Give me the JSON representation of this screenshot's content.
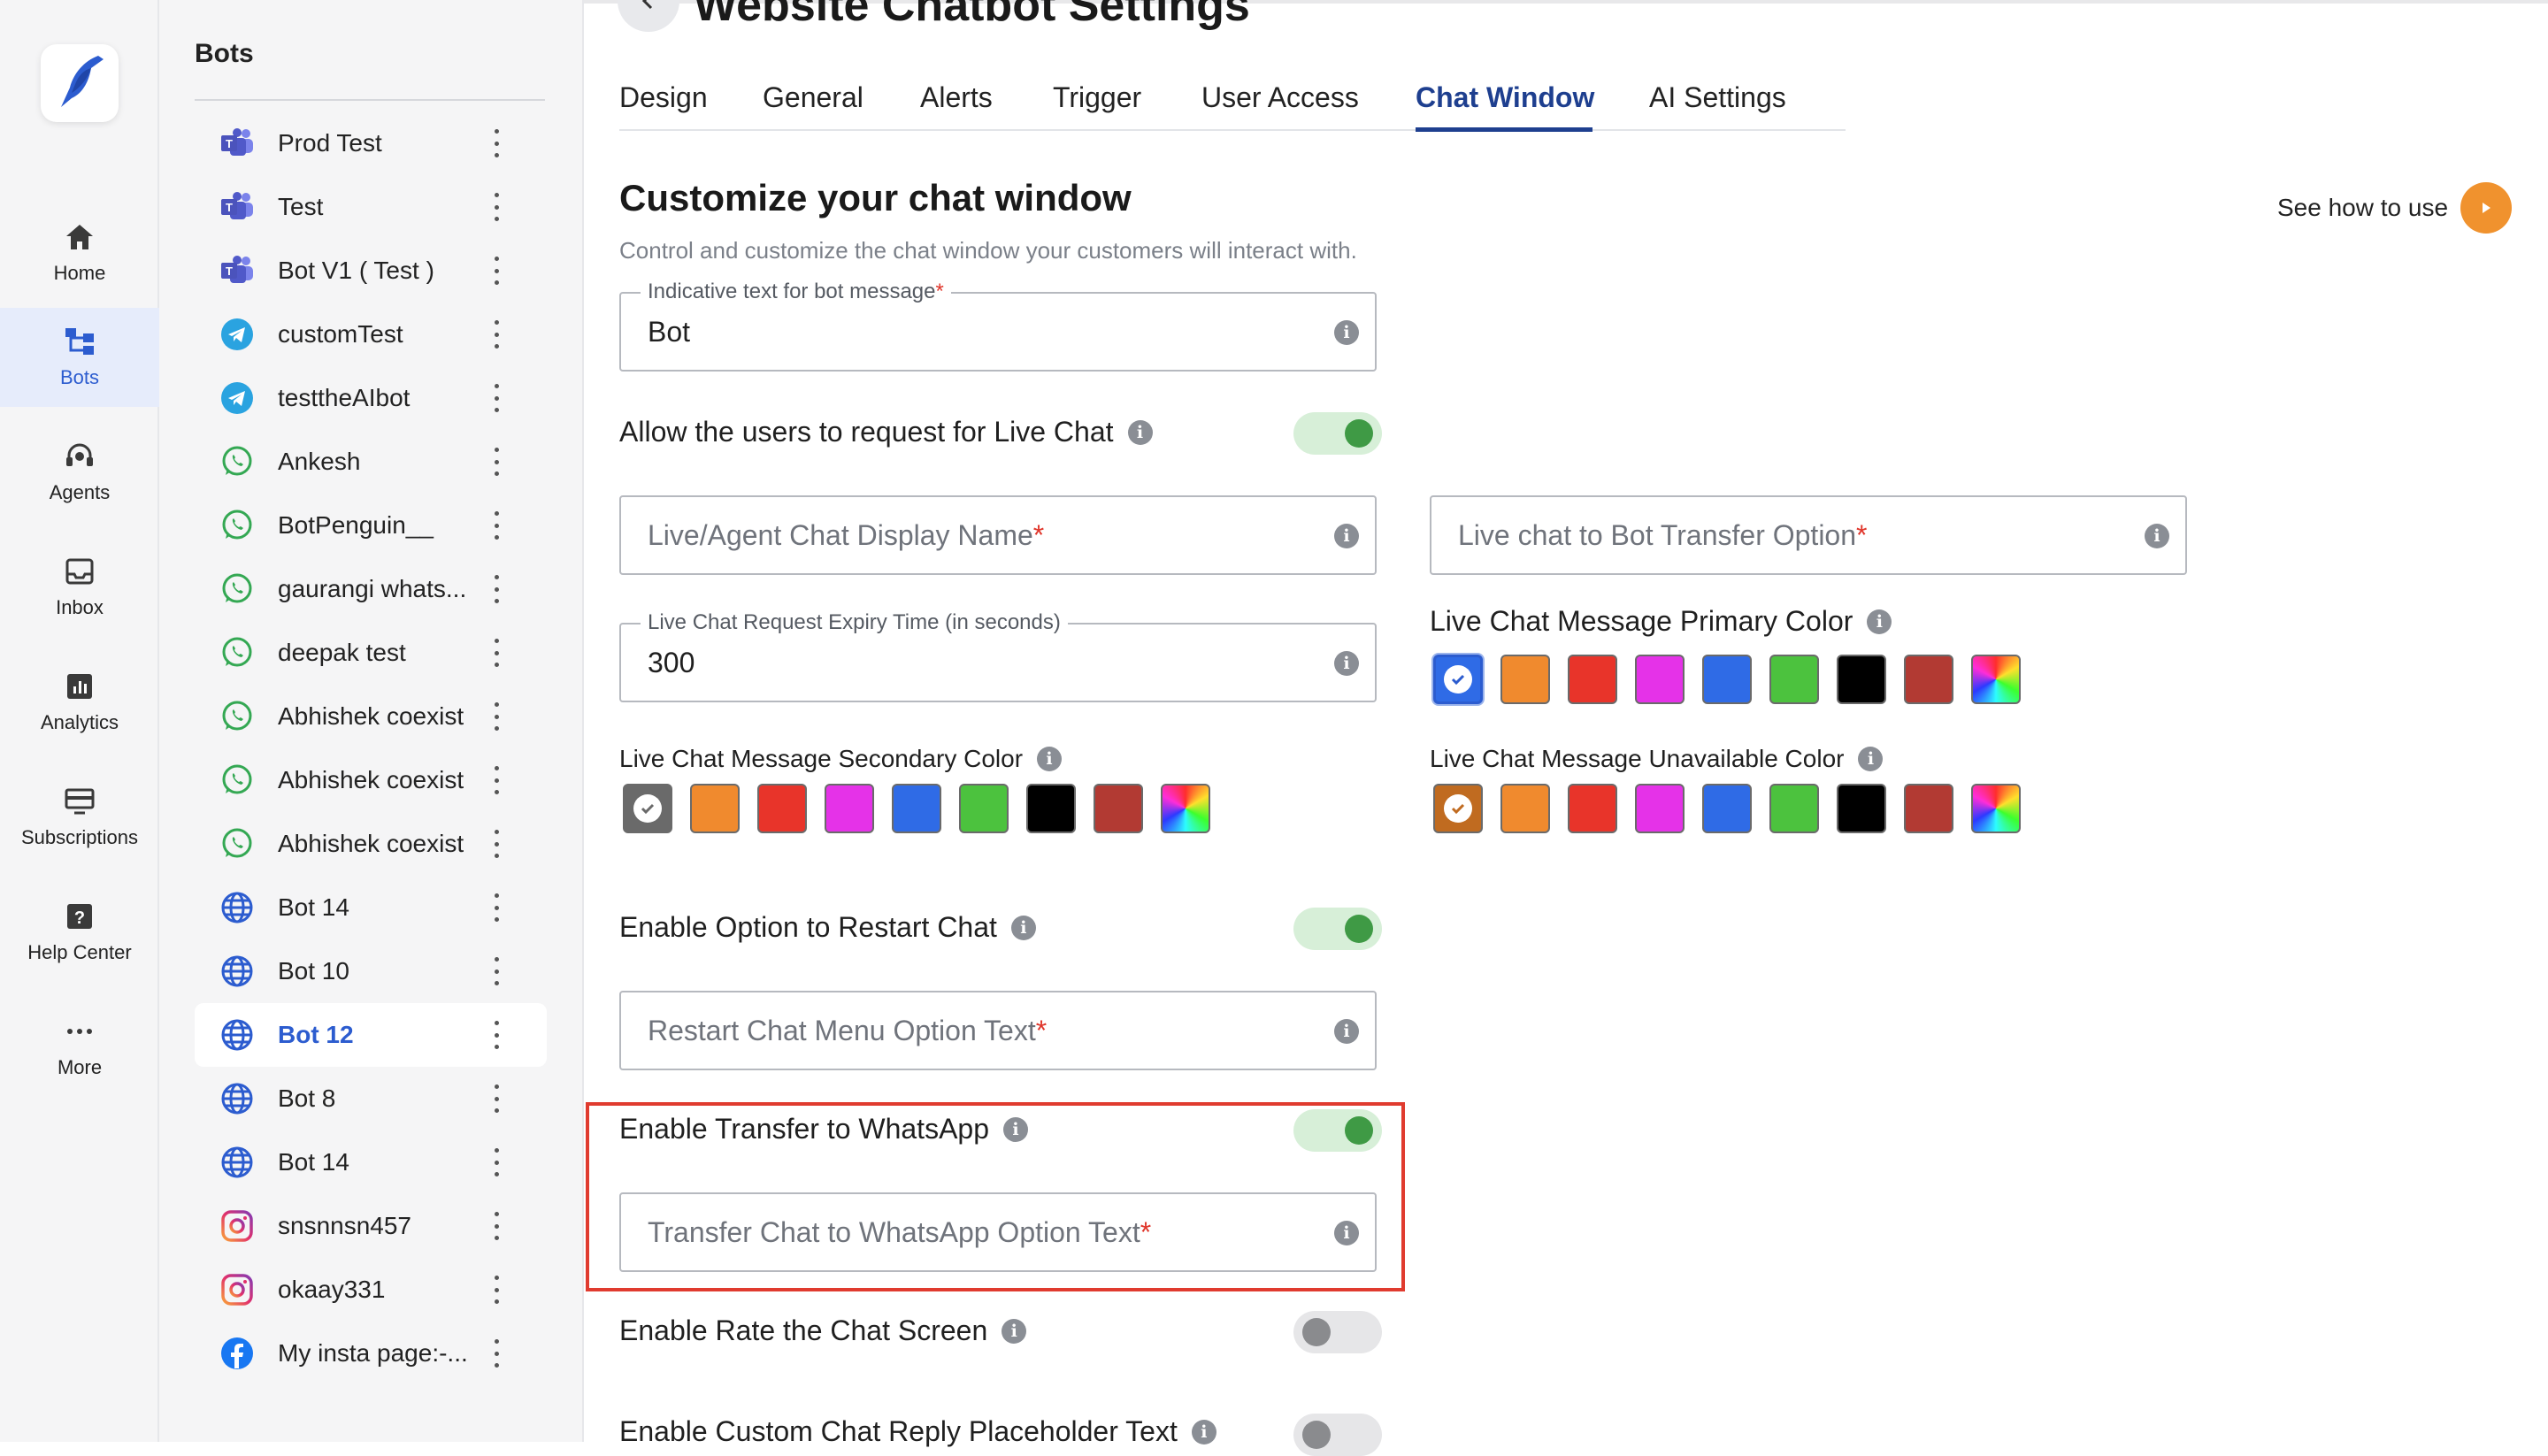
{
  "nav": {
    "items": [
      {
        "label": "Home",
        "icon": "home-icon"
      },
      {
        "label": "Bots",
        "icon": "bots-icon"
      },
      {
        "label": "Agents",
        "icon": "agents-icon"
      },
      {
        "label": "Inbox",
        "icon": "inbox-icon"
      },
      {
        "label": "Analytics",
        "icon": "analytics-icon"
      },
      {
        "label": "Subscriptions",
        "icon": "subscriptions-icon"
      },
      {
        "label": "Help Center",
        "icon": "help-icon"
      },
      {
        "label": "More",
        "icon": "more-icon"
      }
    ],
    "active": "Bots"
  },
  "bots_panel": {
    "title": "Bots",
    "items": [
      {
        "name": "Prod Test",
        "channel": "teams"
      },
      {
        "name": "Test",
        "channel": "teams"
      },
      {
        "name": "Bot V1 ( Test )",
        "channel": "teams"
      },
      {
        "name": "customTest",
        "channel": "telegram"
      },
      {
        "name": "testtheAIbot",
        "channel": "telegram"
      },
      {
        "name": "Ankesh",
        "channel": "whatsapp"
      },
      {
        "name": "BotPenguin__",
        "channel": "whatsapp"
      },
      {
        "name": "gaurangi whats...",
        "channel": "whatsapp"
      },
      {
        "name": "deepak test",
        "channel": "whatsapp"
      },
      {
        "name": "Abhishek coexist",
        "channel": "whatsapp"
      },
      {
        "name": "Abhishek coexist",
        "channel": "whatsapp"
      },
      {
        "name": "Abhishek coexist",
        "channel": "whatsapp"
      },
      {
        "name": "Bot 14",
        "channel": "website"
      },
      {
        "name": "Bot 10",
        "channel": "website"
      },
      {
        "name": "Bot 12",
        "channel": "website",
        "active": true
      },
      {
        "name": "Bot 8",
        "channel": "website"
      },
      {
        "name": "Bot 14",
        "channel": "website"
      },
      {
        "name": "snsnnsn457",
        "channel": "instagram"
      },
      {
        "name": "okaay331",
        "channel": "instagram"
      },
      {
        "name": "My insta page:-...",
        "channel": "facebook"
      }
    ]
  },
  "header": {
    "title": "Website Chatbot Settings",
    "tabs": [
      "Design",
      "General",
      "Alerts",
      "Trigger",
      "User Access",
      "Chat Window",
      "AI Settings"
    ],
    "active_tab": "Chat Window"
  },
  "section": {
    "title": "Customize your chat window",
    "subtitle": "Control and customize the chat window your customers will interact with.",
    "how_to_label": "See how to use"
  },
  "form": {
    "bot_text": {
      "label": "Indicative text for bot message",
      "value": "Bot"
    },
    "live_chat_toggle": {
      "label": "Allow the users to request for Live Chat",
      "on": true
    },
    "agent_display_name": {
      "placeholder": "Live/Agent Chat Display Name"
    },
    "bot_transfer_option": {
      "placeholder": "Live chat to Bot Transfer Option"
    },
    "expiry": {
      "label": "Live Chat Request Expiry Time (in seconds)",
      "value": "300"
    },
    "primary_color": {
      "label": "Live Chat Message Primary Color",
      "selected_index": 0
    },
    "secondary_color": {
      "label": "Live Chat Message Secondary Color",
      "selected_index": 0
    },
    "unavailable_color": {
      "label": "Live Chat Message Unavailable Color",
      "selected_index": 0
    },
    "palette": [
      "#f08a2e",
      "#e8342a",
      "#e532e8",
      "#2f6be6",
      "#4cc23e",
      "#000000",
      "#b23a33"
    ],
    "primary_first": "#2f6be6",
    "secondary_first": "#6a6a6a",
    "unavailable_first": "#c06b20",
    "restart_toggle": {
      "label": "Enable Option to Restart Chat",
      "on": true
    },
    "restart_text": {
      "placeholder": "Restart Chat Menu Option Text"
    },
    "whatsapp_toggle": {
      "label": "Enable Transfer to WhatsApp",
      "on": true
    },
    "whatsapp_text": {
      "placeholder": "Transfer Chat to WhatsApp Option Text"
    },
    "rate_toggle": {
      "label": "Enable Rate the Chat Screen",
      "on": false
    },
    "placeholder_toggle": {
      "label": "Enable Custom Chat Reply Placeholder Text",
      "on": false
    }
  },
  "required_mark": "*",
  "info_glyph": "i",
  "colors": {
    "accent": "#2c5ccf",
    "highlight": "#e03b2f",
    "toggle_on": "#3f9a45"
  }
}
